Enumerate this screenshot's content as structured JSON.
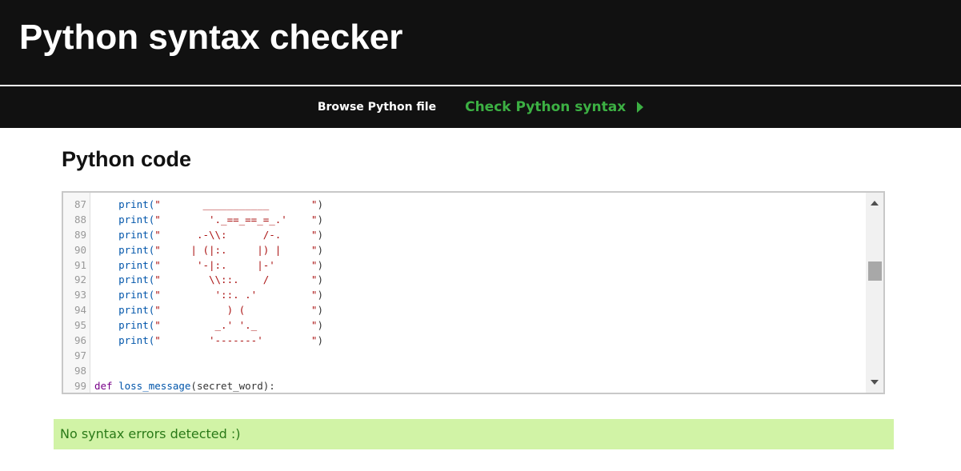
{
  "header": {
    "title": "Python syntax checker"
  },
  "nav": {
    "browse": "Browse Python file",
    "check": "Check Python syntax"
  },
  "section": {
    "title": "Python code"
  },
  "editor": {
    "lines": [
      {
        "n": "87",
        "indent": "    ",
        "fn": "print(",
        "str": "\"       ___________       \"",
        "end": ")"
      },
      {
        "n": "88",
        "indent": "    ",
        "fn": "print(",
        "str": "\"        '._==_==_=_.'    \"",
        "end": ")"
      },
      {
        "n": "89",
        "indent": "    ",
        "fn": "print(",
        "str": "\"      .-\\\\:      /-.     \"",
        "end": ")"
      },
      {
        "n": "90",
        "indent": "    ",
        "fn": "print(",
        "str": "\"     | (|:.     |) |     \"",
        "end": ")"
      },
      {
        "n": "91",
        "indent": "    ",
        "fn": "print(",
        "str": "\"      '-|:.     |-'      \"",
        "end": ")"
      },
      {
        "n": "92",
        "indent": "    ",
        "fn": "print(",
        "str": "\"        \\\\::.    /       \"",
        "end": ")"
      },
      {
        "n": "93",
        "indent": "    ",
        "fn": "print(",
        "str": "\"         '::. .'         \"",
        "end": ")"
      },
      {
        "n": "94",
        "indent": "    ",
        "fn": "print(",
        "str": "\"           ) (           \"",
        "end": ")"
      },
      {
        "n": "95",
        "indent": "    ",
        "fn": "print(",
        "str": "\"         _.' '._         \"",
        "end": ")"
      },
      {
        "n": "96",
        "indent": "    ",
        "fn": "print(",
        "str": "\"        '-------'        \"",
        "end": ")"
      },
      {
        "n": "97",
        "indent": "",
        "fn": "",
        "str": "",
        "end": ""
      },
      {
        "n": "98",
        "indent": "",
        "fn": "",
        "str": "",
        "end": ""
      },
      {
        "n": "99",
        "kw": "def ",
        "name": "loss_message",
        "args": "(secret_word):"
      }
    ]
  },
  "result": {
    "message": "No syntax errors detected :)"
  }
}
